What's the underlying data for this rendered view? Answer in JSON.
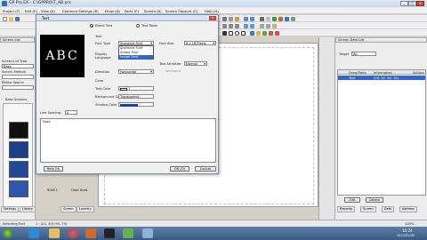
{
  "app": {
    "title": "GP-Pro EX - C:\\GPPRO\\T_AB.prx",
    "min": "_",
    "max": "□",
    "close": "✕"
  },
  "menu": [
    "Project (F)",
    "Edit (E)",
    "View (V)",
    "Common Settings (R)",
    "Draw (D)",
    "Parts (P)",
    "Screen (S)",
    "Screen Capture (C)",
    "Help (H)"
  ],
  "screen_list": {
    "title": "Screen List",
    "screens_of_type_label": "Screens of Type",
    "type_value": "Base",
    "search_method_label": "Search Method",
    "refine_search_label": "Refine Search",
    "base_screens_label": "Base Screens",
    "item_value": "B0001",
    "item_name": "Data Data"
  },
  "dialog": {
    "title": "Text",
    "radio_direct": "Direct Text",
    "radio_table": "Text Table",
    "preview_text": "ABC",
    "text_section": "Text",
    "font_type_label": "Font Type",
    "font_type_value": "Standard Font",
    "font_type_options": [
      "Standard Font",
      "Stroke Font",
      "Image Font"
    ],
    "font_size_label": "Font Size",
    "font_size_value": "8 x 16 Pixels",
    "display_language_label": "Display Language",
    "text_attribute_label": "Text Attribute",
    "text_attribute_value": "Normal",
    "keyboard_label": "Keyboard",
    "direction_label": "Direction",
    "direction_value": "Horizontal",
    "color_section": "Color",
    "text_color_label": "Text Color",
    "text_color_value": "7",
    "bg_color_label": "Background Color",
    "bg_color_value": "Transparent",
    "shadow_color_label": "Shadow Color",
    "line_spacing_label": "Line Spacing",
    "line_spacing_value": "0",
    "text_body": "Data",
    "help": "Help (H)",
    "ok": "OK (O)",
    "cancel": "Cancel"
  },
  "screen_data_list": {
    "title": "Screen Data List",
    "target_label": "Target",
    "target_value": "All",
    "columns": [
      "Draw/Parts",
      "Information",
      "Actions"
    ],
    "rows": [
      {
        "name": "Text",
        "info": "(24, 30, 95, 70)",
        "action": ""
      }
    ],
    "edit": "Edit",
    "delete": "Delete"
  },
  "left_tabs": [
    "Settings",
    "Library",
    "Screen",
    "Laundry"
  ],
  "right_tabs": [
    "Property",
    "Screen",
    "Data",
    "Address"
  ],
  "status": {
    "text": "Selecting Text",
    "coords": "1 : (24, 30)  (95, 70)",
    "zoom": "100%"
  },
  "clock": {
    "time": "10:24",
    "date": "2013/02/02"
  },
  "colors": {
    "taskbar": "#3b5a83",
    "selection": "#3366cc",
    "accent": "#cddcf0"
  }
}
